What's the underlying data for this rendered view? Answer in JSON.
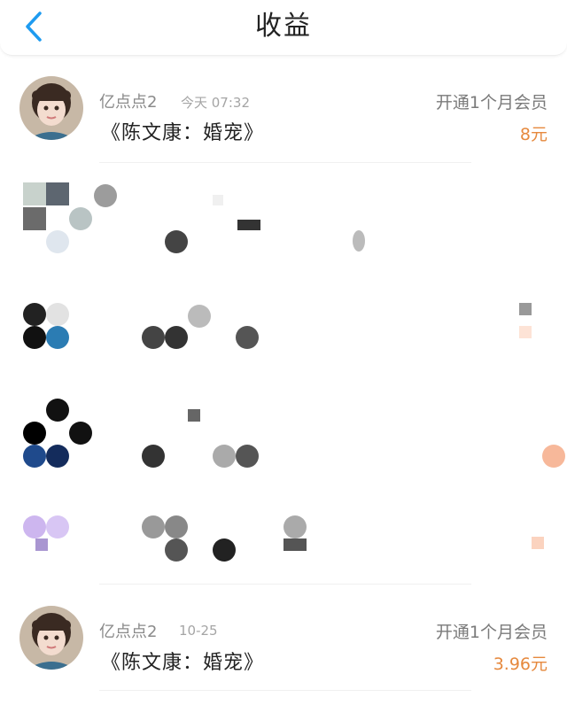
{
  "header": {
    "title": "收益",
    "back_icon": "chevron-left-icon"
  },
  "records": [
    {
      "user": "亿点点2",
      "time": "今天 07:32",
      "book": "《陈文康：婚宠》",
      "description": "开通1个月会员",
      "amount": "8元"
    },
    {
      "user": "亿点点2",
      "time": "10-25",
      "book": "《陈文康：婚宠》",
      "description": "开通1个月会员",
      "amount": "3.96元"
    }
  ],
  "colors": {
    "accent": "#1e9bf0",
    "amount": "#e6893e",
    "title": "#222222",
    "secondary": "#8a8a8a"
  }
}
